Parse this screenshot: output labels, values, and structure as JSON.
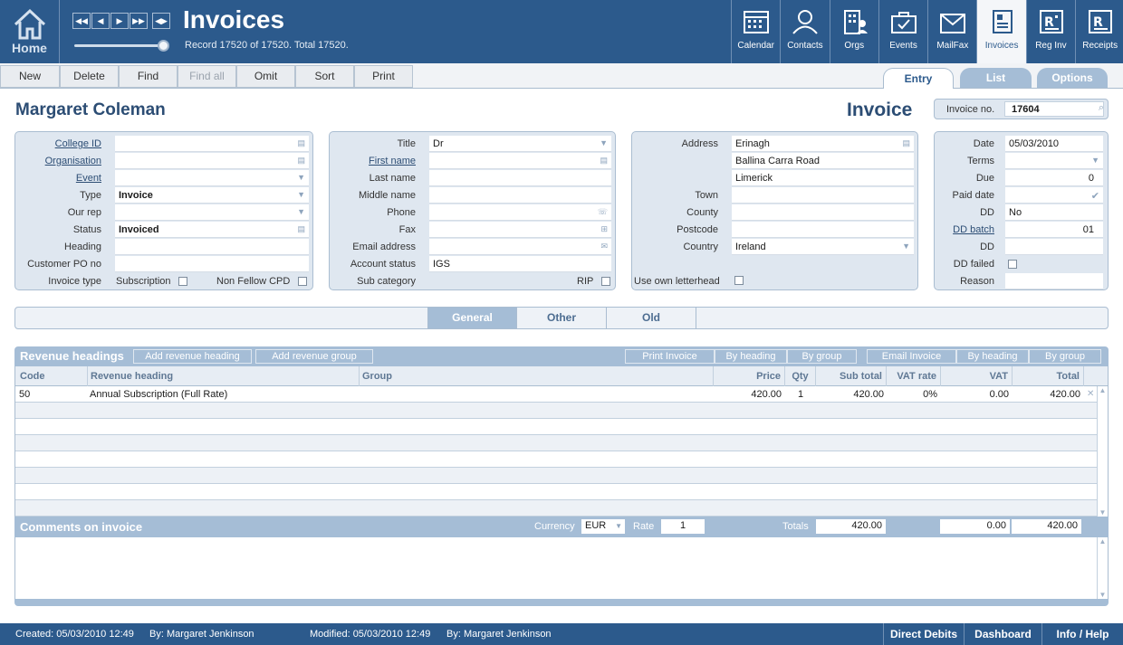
{
  "header": {
    "home_label": "Home",
    "title": "Invoices",
    "record_info": "Record 17520 of 17520. Total 17520.",
    "nav": [
      "⏮",
      "◀",
      "▶",
      "⏭",
      "⇔"
    ],
    "modules": [
      {
        "label": "Calendar",
        "icon": "calendar-icon"
      },
      {
        "label": "Contacts",
        "icon": "person-icon"
      },
      {
        "label": "Orgs",
        "icon": "building-icon"
      },
      {
        "label": "Events",
        "icon": "briefcase-icon"
      },
      {
        "label": "MailFax",
        "icon": "envelope-icon"
      },
      {
        "label": "Invoices",
        "icon": "invoice-icon"
      },
      {
        "label": "Reg Inv",
        "icon": "reg-invoice-icon"
      },
      {
        "label": "Receipts",
        "icon": "receipt-icon"
      }
    ]
  },
  "toolbar": {
    "new": "New",
    "delete": "Delete",
    "find": "Find",
    "find_all": "Find all",
    "omit": "Omit",
    "sort": "Sort",
    "print": "Print"
  },
  "view_tabs": {
    "entry": "Entry",
    "list": "List",
    "options": "Options"
  },
  "record": {
    "customer_name": "Margaret Coleman",
    "doc_title": "Invoice",
    "invoice_no_label": "Invoice no.",
    "invoice_no": "17604"
  },
  "panel1": {
    "college_id": "College ID",
    "organisation": "Organisation",
    "event": "Event",
    "type": "Type",
    "type_value": "Invoice",
    "our_rep": "Our rep",
    "status": "Status",
    "status_value": "Invoiced",
    "heading": "Heading",
    "customer_po": "Customer PO no",
    "invoice_type": "Invoice type",
    "subscription": "Subscription",
    "non_fellow_cpd": "Non Fellow CPD"
  },
  "panel2": {
    "title": "Title",
    "title_value": "Dr",
    "first_name": "First name",
    "last_name": "Last name",
    "middle_name": "Middle name",
    "phone": "Phone",
    "fax": "Fax",
    "email": "Email address",
    "account_status": "Account status",
    "account_status_value": "IGS",
    "sub_category": "Sub category",
    "rip": "RIP"
  },
  "panel3": {
    "address": "Address",
    "address_line1": "Erinagh",
    "address_line2": "Ballina Carra Road",
    "address_line3": "Limerick",
    "town": "Town",
    "county": "County",
    "postcode": "Postcode",
    "country": "Country",
    "country_value": "Ireland",
    "own_letterhead": "Use own letterhead"
  },
  "panel4": {
    "date": "Date",
    "date_value": "05/03/2010",
    "terms": "Terms",
    "due": "Due",
    "due_value": "0",
    "paid_date": "Paid date",
    "dd": "DD",
    "dd_value": "No",
    "dd_batch": "DD batch",
    "dd_batch_value": "01",
    "dd2": "DD",
    "dd_failed": "DD failed",
    "reason": "Reason"
  },
  "section_tabs": {
    "general": "General",
    "other": "Other",
    "old": "Old"
  },
  "revenue": {
    "title": "Revenue headings",
    "add_heading": "Add revenue heading",
    "add_group": "Add revenue group",
    "print_invoice": "Print Invoice",
    "by_heading_1": "By heading",
    "by_group_1": "By group",
    "email_invoice": "Email Invoice",
    "by_heading_2": "By heading",
    "by_group_2": "By group",
    "columns": {
      "code": "Code",
      "heading": "Revenue heading",
      "group": "Group",
      "price": "Price",
      "qty": "Qty",
      "subtotal": "Sub total",
      "vat_rate": "VAT rate",
      "vat": "VAT",
      "total": "Total"
    },
    "rows": [
      {
        "code": "50",
        "heading": "Annual Subscription (Full Rate)",
        "group": "",
        "price": "420.00",
        "qty": "1",
        "subtotal": "420.00",
        "vat_rate": "0%",
        "vat": "0.00",
        "total": "420.00"
      }
    ]
  },
  "comments": {
    "title": "Comments on invoice",
    "currency_label": "Currency",
    "currency_value": "EUR",
    "rate_label": "Rate",
    "rate_value": "1",
    "totals_label": "Totals",
    "subtotal": "420.00",
    "vat": "0.00",
    "total": "420.00"
  },
  "status": {
    "created": "Created:  05/03/2010  12:49",
    "created_by": "By:  Margaret Jenkinson",
    "modified": "Modified:  05/03/2010  12:49",
    "modified_by": "By:  Margaret Jenkinson",
    "direct_debits": "Direct Debits",
    "dashboard": "Dashboard",
    "info_help": "Info / Help"
  },
  "colors": {
    "header_blue": "#2c5a8c",
    "panel_fill": "#dfe7f0",
    "accent_light": "#a5bdd6"
  }
}
